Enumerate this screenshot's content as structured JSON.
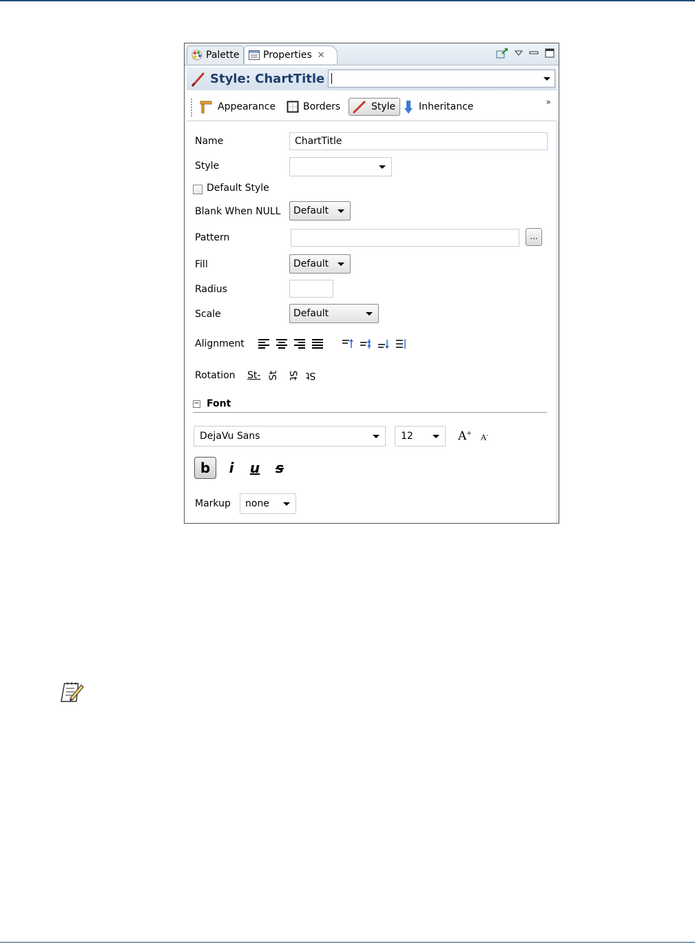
{
  "tabs": {
    "palette": "Palette",
    "properties": "Properties"
  },
  "view_icons": [
    "pin-icon",
    "view-menu-icon",
    "minimize-icon",
    "maximize-icon"
  ],
  "title": {
    "text": "Style: ChartTitle",
    "combo_value": ""
  },
  "subtabs": {
    "appearance": "Appearance",
    "borders": "Borders",
    "style": "Style",
    "inheritance": "Inheritance",
    "more": "»"
  },
  "form": {
    "name_label": "Name",
    "name_value": "ChartTitle",
    "style_label": "Style",
    "style_value": "",
    "default_style_label": "Default Style",
    "default_style_checked": false,
    "blank_when_null_label": "Blank When NULL",
    "blank_when_null_value": "Default",
    "pattern_label": "Pattern",
    "pattern_value": "",
    "pattern_button": "...",
    "fill_label": "Fill",
    "fill_value": "Default",
    "radius_label": "Radius",
    "radius_value": "",
    "scale_label": "Scale",
    "scale_value": "Default",
    "alignment_label": "Alignment",
    "rotation_label": "Rotation",
    "rotation_options": [
      "St-",
      "St",
      "St",
      "St"
    ]
  },
  "font": {
    "section_title": "Font",
    "family": "DejaVu Sans",
    "size": "12",
    "grow_label": "A",
    "shrink_label": "A",
    "bold_label": "b",
    "italic_label": "i",
    "underline_label": "u",
    "strike_label": "s",
    "bold_active": true,
    "markup_label": "Markup",
    "markup_value": "none"
  },
  "colors": {
    "title_text": "#1f3f6b",
    "accent": "#1f4e79"
  }
}
